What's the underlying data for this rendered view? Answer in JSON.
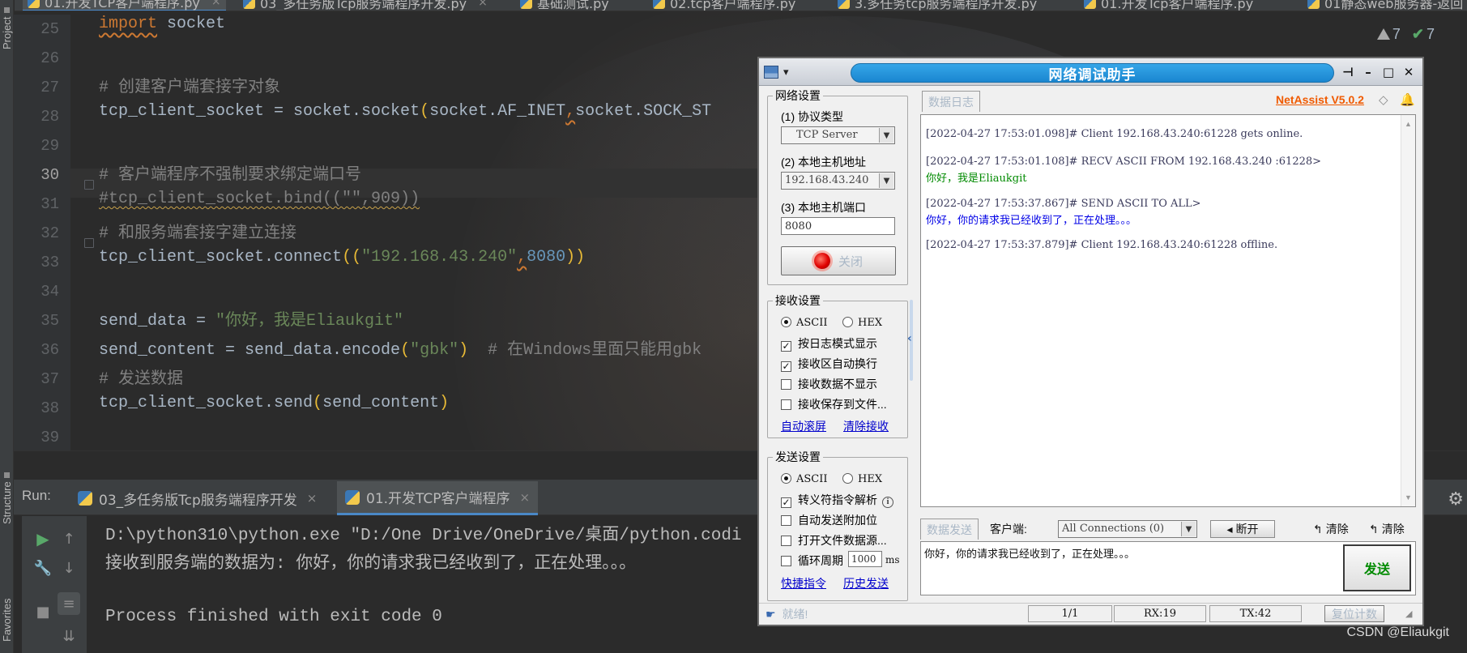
{
  "ide": {
    "tabs": [
      {
        "label": "01.开发TCP客户端程序.py",
        "close": "×"
      },
      {
        "label": "03_多任务版Tcp服务端程序开发.py",
        "close": "×"
      },
      {
        "label": "基础测试.py"
      },
      {
        "label": "02.tcp客户端程序.py"
      },
      {
        "label": "3.多任务tcp服务端程序开发.py"
      },
      {
        "label": "01.开发Tcp客户端程序.py"
      },
      {
        "label": "01静态web服务器-返回"
      }
    ],
    "left_strip": {
      "project": "Project",
      "structure": "Structure",
      "favorites": "Favorites"
    },
    "warning_count": "7",
    "ok_count": "7"
  },
  "editor": {
    "line_numbers": [
      "25",
      "26",
      "27",
      "28",
      "29",
      "30",
      "31",
      "32",
      "33",
      "34",
      "35",
      "36",
      "37",
      "38",
      "39"
    ],
    "current_line": "30",
    "lines": [
      [
        {
          "t": "import",
          "c": "c-warn"
        },
        {
          "t": " socket",
          "c": "c-df"
        }
      ],
      [],
      [
        {
          "t": "# 创建客户端套接字对象",
          "c": "c-cm"
        }
      ],
      [
        {
          "t": "tcp_client_socket = socket.socket",
          "c": "c-df"
        },
        {
          "t": "(",
          "c": "c-pr"
        },
        {
          "t": "socket.AF_INET",
          "c": "c-df"
        },
        {
          "t": ",",
          "c": "c-warn"
        },
        {
          "t": "socket.SOCK_ST",
          "c": "c-df"
        }
      ],
      [],
      [
        {
          "t": "# 客户端程序不强制要求绑定端口号",
          "c": "c-cm"
        }
      ],
      [
        {
          "t": "#tcp_client_socket.bind((\"\",909))",
          "c": "c-cmwv"
        }
      ],
      [
        {
          "t": "# 和服务端套接字建立连接",
          "c": "c-cm"
        }
      ],
      [
        {
          "t": "tcp_client_socket.connect",
          "c": "c-df"
        },
        {
          "t": "((",
          "c": "c-pr"
        },
        {
          "t": "\"192.168.43.240\"",
          "c": "c-str"
        },
        {
          "t": ",",
          "c": "c-warn"
        },
        {
          "t": "8080",
          "c": "c-num"
        },
        {
          "t": "))",
          "c": "c-pr"
        }
      ],
      [],
      [
        {
          "t": "send_data = ",
          "c": "c-df"
        },
        {
          "t": "\"你好，我是Eliaukgit\"",
          "c": "c-str"
        }
      ],
      [
        {
          "t": "send_content = send_data.encode",
          "c": "c-df"
        },
        {
          "t": "(",
          "c": "c-pr"
        },
        {
          "t": "\"gbk\"",
          "c": "c-str"
        },
        {
          "t": ")",
          "c": "c-pr"
        },
        {
          "t": "  # 在Windows里面只能用gbk",
          "c": "c-cm"
        }
      ],
      [
        {
          "t": "# 发送数据",
          "c": "c-cm"
        }
      ],
      [
        {
          "t": "tcp_client_socket.send",
          "c": "c-df"
        },
        {
          "t": "(",
          "c": "c-pr"
        },
        {
          "t": "send_content",
          "c": "c-df"
        },
        {
          "t": ")",
          "c": "c-pr"
        }
      ],
      []
    ]
  },
  "run": {
    "label": "Run:",
    "tabs": [
      {
        "label": "03_多任务版Tcp服务端程序开发",
        "close": "×"
      },
      {
        "label": "01.开发TCP客户端程序",
        "close": "×"
      }
    ],
    "console": [
      "D:\\python310\\python.exe \"D:/One Drive/OneDrive/桌面/python.codi",
      "接收到服务端的数据为: 你好，你的请求我已经收到了，正在处理。。。",
      "",
      "Process finished with exit code 0"
    ]
  },
  "netassist": {
    "title": "网络调试助手",
    "brand": "NetAssist V5.0.2",
    "net_settings": {
      "title": "网络设置",
      "protocol_label": "(1) 协议类型",
      "protocol_value": "TCP Server",
      "host_label": "(2) 本地主机地址",
      "host_value": "192.168.43.240",
      "port_label": "(3) 本地主机端口",
      "port_value": "8080",
      "close_button": "关闭"
    },
    "recv_settings": {
      "title": "接收设置",
      "ascii": "ASCII",
      "hex": "HEX",
      "options": [
        {
          "label": "按日志模式显示",
          "checked": true
        },
        {
          "label": "接收区自动换行",
          "checked": true
        },
        {
          "label": "接收数据不显示",
          "checked": false
        },
        {
          "label": "接收保存到文件...",
          "checked": false
        }
      ],
      "link_autoscroll": "自动滚屏",
      "link_clear": "清除接收"
    },
    "send_settings": {
      "title": "发送设置",
      "ascii": "ASCII",
      "hex": "HEX",
      "options": [
        {
          "label": "转义符指令解析",
          "checked": true
        },
        {
          "label": "自动发送附加位",
          "checked": false
        },
        {
          "label": "打开文件数据源...",
          "checked": false
        },
        {
          "label": "循环周期",
          "checked": false
        }
      ],
      "cycle_value": "1000",
      "cycle_unit": "ms",
      "link_shortcuts": "快捷指令",
      "link_history": "历史发送"
    },
    "log_tab": "数据日志",
    "log": [
      {
        "text": "[2022-04-27 17:53:01.098]# Client 192.168.43.240:61228 gets online.",
        "kind": "lg-sys"
      },
      {
        "text": "[2022-04-27 17:53:01.108]# RECV ASCII FROM 192.168.43.240 :61228>",
        "kind": "lg-sys"
      },
      {
        "text": "你好，我是Eliaukgit",
        "kind": "lg-green"
      },
      {
        "text": "[2022-04-27 17:53:37.867]# SEND ASCII TO ALL>",
        "kind": "lg-sys"
      },
      {
        "text": "你好，你的请求我已经收到了，正在处理。。。",
        "kind": "lg-blue"
      },
      {
        "text": "[2022-04-27 17:53:37.879]# Client 192.168.43.240:61228 offline.",
        "kind": "lg-sys"
      }
    ],
    "send_row": {
      "tab": "数据发送",
      "client_label": "客户端:",
      "client_value": "All Connections (0)",
      "disconnect": "断开",
      "clear1": "清除",
      "clear2": "清除"
    },
    "send_text": "你好，你的请求我已经收到了，正在处理。。。",
    "send_button": "发送",
    "status": {
      "ready": "就绪!",
      "page": "1/1",
      "rx": "RX:19",
      "tx": "TX:42",
      "reset": "复位计数"
    }
  },
  "watermark": "CSDN @Eliaukgit"
}
